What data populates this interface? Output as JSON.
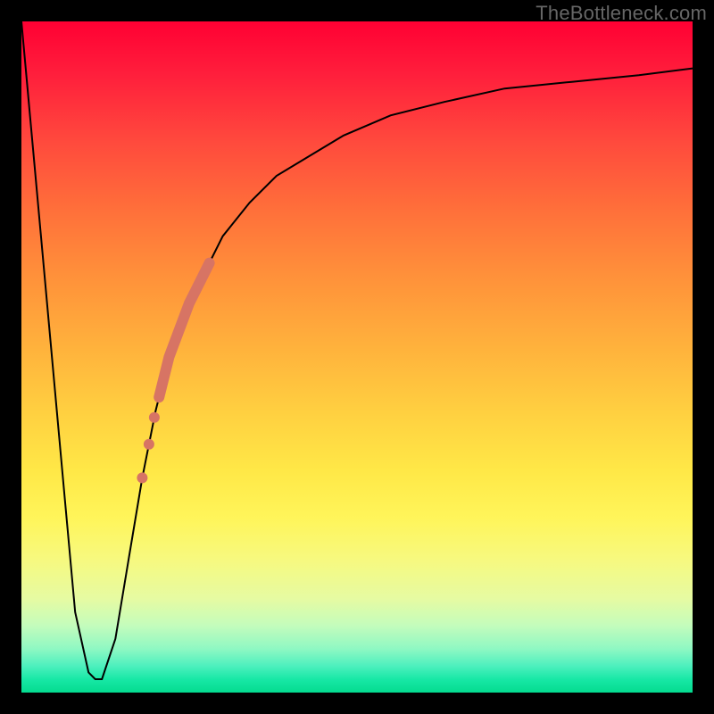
{
  "attribution": "TheBottleneck.com",
  "chart_data": {
    "type": "line",
    "title": "",
    "xlabel": "",
    "ylabel": "",
    "xlim": [
      0,
      100
    ],
    "ylim": [
      0,
      100
    ],
    "grid": false,
    "legend": false,
    "background_gradient": {
      "direction": "vertical",
      "stops": [
        {
          "pos": 0.0,
          "color": "#ff0033"
        },
        {
          "pos": 0.18,
          "color": "#ff4a3d"
        },
        {
          "pos": 0.38,
          "color": "#ff913a"
        },
        {
          "pos": 0.58,
          "color": "#ffcf40"
        },
        {
          "pos": 0.74,
          "color": "#fff55a"
        },
        {
          "pos": 0.86,
          "color": "#e6fba2"
        },
        {
          "pos": 0.94,
          "color": "#8ef8c3"
        },
        {
          "pos": 1.0,
          "color": "#04db8f"
        }
      ]
    },
    "series": [
      {
        "name": "bottleneck-curve",
        "color": "#000000",
        "stroke_width": 2,
        "x": [
          0,
          3,
          6,
          8,
          10,
          11,
          12,
          14,
          16,
          18,
          20,
          22,
          24,
          27,
          30,
          34,
          38,
          43,
          48,
          55,
          63,
          72,
          82,
          92,
          100
        ],
        "values": [
          100,
          67,
          34,
          12,
          3,
          2,
          2,
          8,
          20,
          32,
          42,
          50,
          56,
          62,
          68,
          73,
          77,
          80,
          83,
          86,
          88,
          90,
          91,
          92,
          93
        ]
      },
      {
        "name": "highlight-band",
        "color": "#d77464",
        "stroke_width": 12,
        "x": [
          20.5,
          22,
          23.5,
          25,
          26.5,
          28
        ],
        "values": [
          44,
          50,
          54,
          58,
          61,
          64
        ]
      }
    ],
    "markers": [
      {
        "name": "highlight-dot-1",
        "x": 19.0,
        "y": 37,
        "r": 6,
        "color": "#d77464"
      },
      {
        "name": "highlight-dot-2",
        "x": 19.8,
        "y": 41,
        "r": 6,
        "color": "#d77464"
      },
      {
        "name": "highlight-dot-3",
        "x": 18.0,
        "y": 32,
        "r": 6,
        "color": "#d77464"
      }
    ]
  }
}
